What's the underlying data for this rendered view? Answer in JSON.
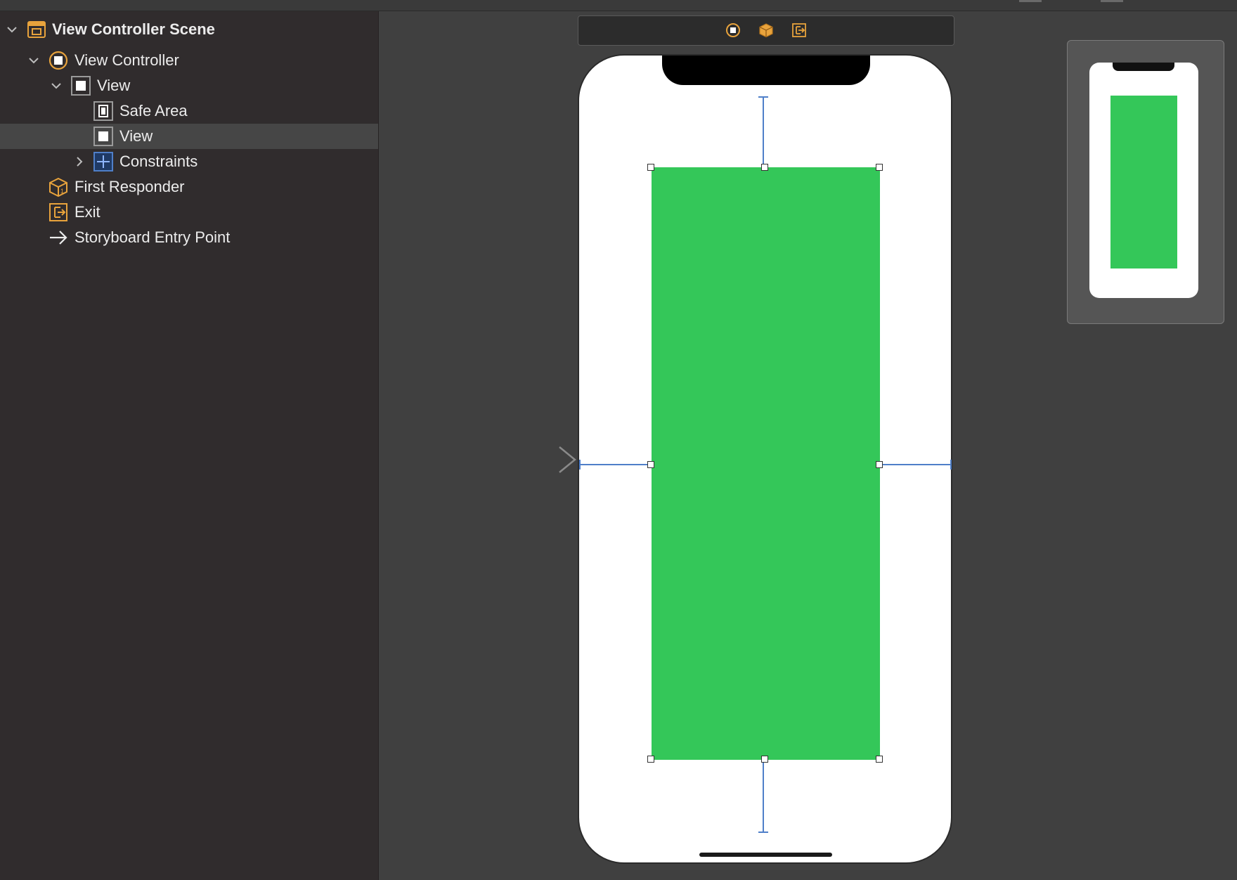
{
  "outline": {
    "items": [
      {
        "label": "View Controller Scene",
        "icon": "scene-icon",
        "expanded": true
      },
      {
        "label": "View Controller",
        "icon": "view-controller-icon",
        "expanded": true
      },
      {
        "label": "View",
        "icon": "view-icon",
        "expanded": true
      },
      {
        "label": "Safe Area",
        "icon": "safe-area-icon"
      },
      {
        "label": "View",
        "icon": "view-icon",
        "selected": true
      },
      {
        "label": "Constraints",
        "icon": "constraints-icon",
        "expanded": false
      },
      {
        "label": "First Responder",
        "icon": "first-responder-icon"
      },
      {
        "label": "Exit",
        "icon": "exit-icon"
      },
      {
        "label": "Storyboard Entry Point",
        "icon": "entry-arrow-icon"
      }
    ]
  },
  "scene_dock": {
    "icons": [
      "view-controller-icon",
      "first-responder-icon",
      "exit-icon"
    ]
  },
  "canvas": {
    "subview_color": "#34c759",
    "constraint_color": "#4f7fc9",
    "accent_orange": "#e8a33c"
  }
}
